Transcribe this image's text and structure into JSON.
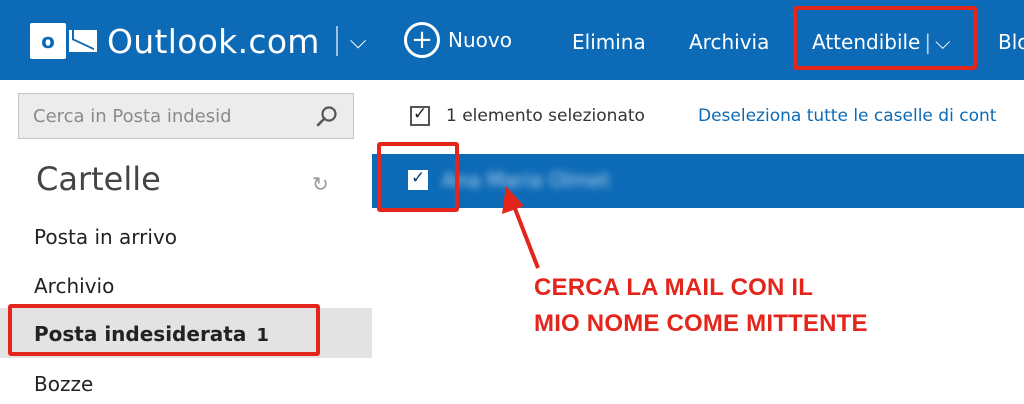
{
  "header": {
    "logo_letter": "o",
    "brand": "Outlook.com",
    "new_label": "Nuovo",
    "commands": {
      "delete": "Elimina",
      "archive": "Archivia",
      "trusted": "Attendibile",
      "block": "Blo"
    },
    "accent": "#0c6ab6"
  },
  "sidebar": {
    "search_placeholder": "Cerca in Posta indesid",
    "folders_title": "Cartelle",
    "folders": {
      "inbox": "Posta in arrivo",
      "archive": "Archivio",
      "junk": "Posta indesiderata",
      "junk_count": "1",
      "drafts": "Bozze"
    }
  },
  "list": {
    "selected_count": "1 elemento selezionato",
    "deselect_all": "Deseleziona tutte le caselle di cont",
    "row_sender": "Ana Maria Olmet"
  },
  "annotation": {
    "line1": "CERCA LA MAIL CON IL",
    "line2": "MIO NOME COME MITTENTE",
    "color": "#e4251c"
  }
}
